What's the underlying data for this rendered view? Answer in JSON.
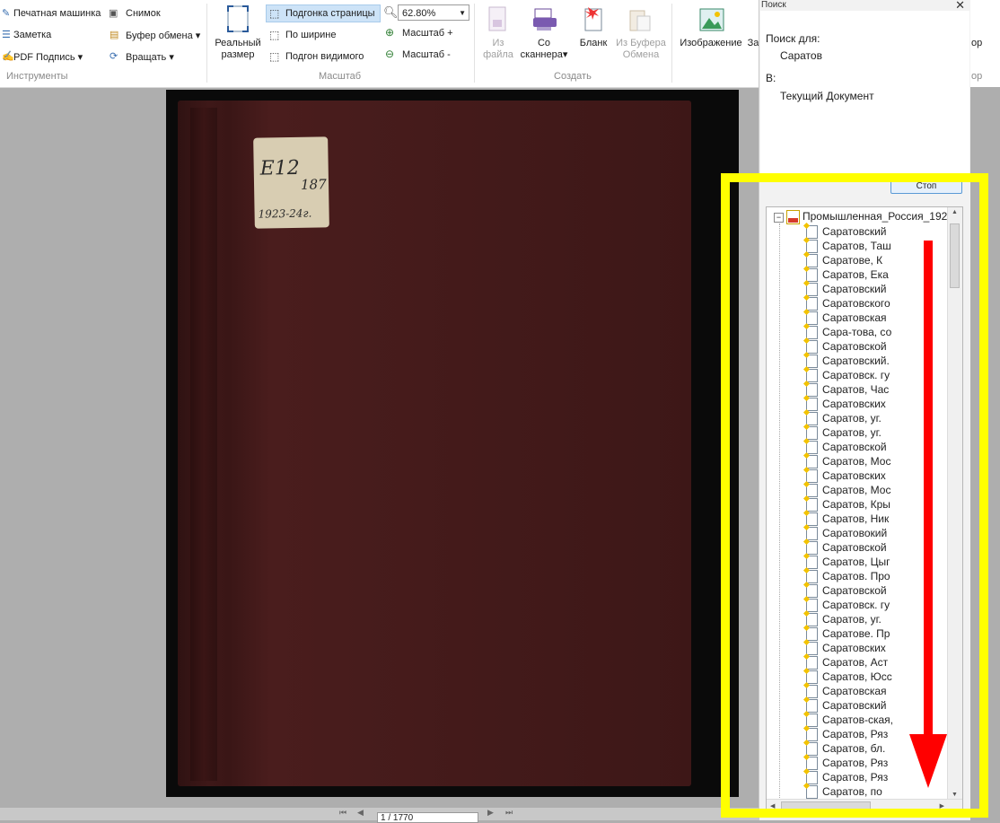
{
  "toolbar": {
    "tools": {
      "typewriter": "Печатная машинка",
      "note": "Заметка",
      "pdf_sign": "PDF Подпись",
      "snapshot": "Снимок",
      "clipboard": "Буфер обмена",
      "rotate": "Вращать",
      "group_label": "Инструменты"
    },
    "zoom": {
      "actual_size_line1": "Реальный",
      "actual_size_line2": "размер",
      "fit_page": "Подгонка страницы",
      "fit_width": "По ширине",
      "fit_visible": "Подгон видимого",
      "zoom_value": "62.80%",
      "zoom_in": "Масштаб +",
      "zoom_out": "Масштаб -",
      "group_label": "Масштаб"
    },
    "create": {
      "from_file_line1": "Из",
      "from_file_line2": "файла",
      "from_scanner_line1": "Со",
      "from_scanner_line2": "сканнера",
      "blank": "Бланк",
      "from_clipboard_line1": "Из Буфера",
      "from_clipboard_line2": "Обмена",
      "group_label": "Создать"
    },
    "image": "Изображение",
    "partial_right_1": "За",
    "partial_right_2": "ор",
    "partial_right_3": "ор"
  },
  "document": {
    "label_line1": "E12",
    "label_line2": "187",
    "label_line3": "1923-24г.",
    "page_field": "1 / 1770"
  },
  "search_panel": {
    "title": "Поиск",
    "search_for_label": "Поиск для:",
    "search_for_value": "Саратов",
    "in_label": "В:",
    "in_value": "Текущий Документ",
    "stop_label": "Стоп",
    "root": "Промышленная_Россия_192",
    "results": [
      "Саратовский",
      "Саратов, Таш",
      "Саратове, К",
      "Саратов, Ека",
      "Саратовский",
      "Саратовского",
      "Саратовская",
      "Сара-това, со",
      "Саратовской",
      "Саратовский.",
      "Саратовск. гу",
      "Саратов, Час",
      "Саратовских",
      "Саратов, уг.",
      "Саратов, уг.",
      "Саратовской",
      "Саратов, Мос",
      "Саратовских",
      "Саратов, Мос",
      "Саратов, Кры",
      "Саратов, Ник",
      "Саратовокий",
      "Саратовской",
      "Саратов, Цыг",
      "Саратов. Про",
      "Саратовской",
      "Саратовск. гу",
      "Саратов, уг.",
      "Саратове. Пр",
      "Саратовских",
      "Саратов, Аст",
      "Саратов, Юсс",
      "Саратовская",
      "Саратовский",
      "Саратов-ская,",
      "Саратов, Ряз",
      "Саратов, бл.",
      "Саратов, Ряз",
      "Саратов, Ряз",
      "Саратов, по"
    ]
  },
  "colors": {
    "highlight_box": "#ffff00",
    "arrow": "#ff0000",
    "cover": "#421a1a"
  }
}
